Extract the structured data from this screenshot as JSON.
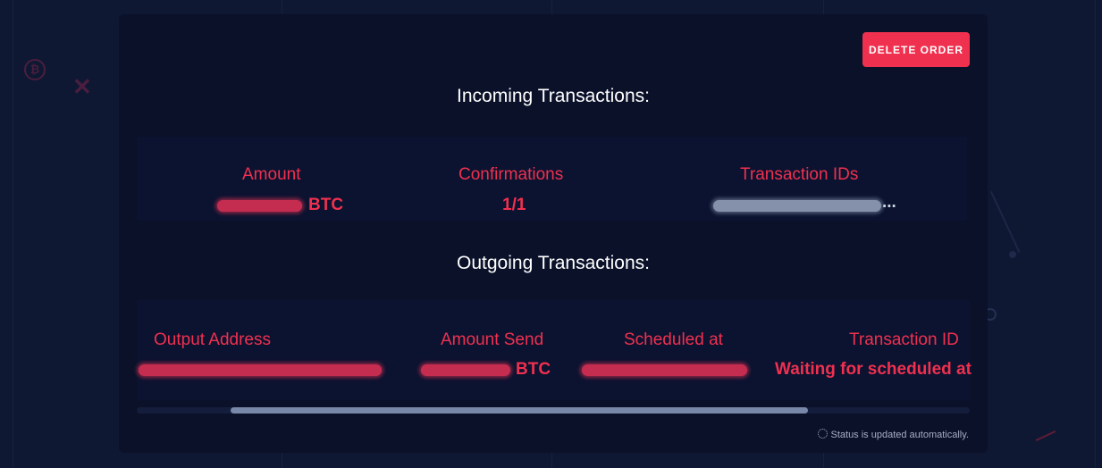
{
  "modal": {
    "delete_button": "DELETE ORDER",
    "status_text": "Status is updated automatically."
  },
  "incoming": {
    "title": "Incoming Transactions:",
    "headers": {
      "amount": "Amount",
      "confirmations": "Confirmations",
      "transaction_ids": "Transaction IDs"
    },
    "row": {
      "amount_unit": "BTC",
      "confirmations": "1/1",
      "transaction_id_suffix": "..."
    }
  },
  "outgoing": {
    "title": "Outgoing Transactions:",
    "headers": {
      "output_address": "Output Address",
      "amount_send": "Amount Send",
      "scheduled_at": "Scheduled at",
      "transaction_id": "Transaction ID"
    },
    "row": {
      "amount_unit": "BTC",
      "transaction_id": "Waiting for scheduled at"
    }
  },
  "colors": {
    "accent": "#f0304f",
    "modal_bg": "#0a1129",
    "page_bg": "#0f1833"
  }
}
